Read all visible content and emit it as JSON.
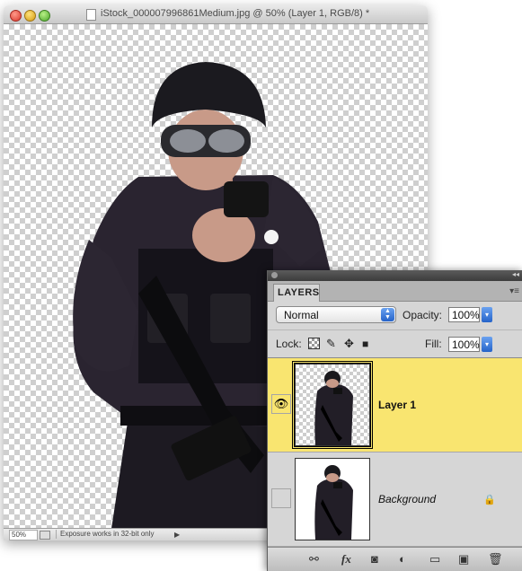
{
  "document": {
    "title": "iStock_000007996861Medium.jpg @ 50% (Layer 1, RGB/8) *",
    "status": {
      "zoom": "50%",
      "info": "Exposure works in 32-bit only"
    },
    "icons": [
      "close-icon",
      "minimize-icon",
      "zoom-icon",
      "document-icon"
    ]
  },
  "layers_panel": {
    "tab_label": "LAYERS",
    "blend_mode": "Normal",
    "opacity_label": "Opacity:",
    "opacity_value": "100%",
    "lock_label": "Lock:",
    "fill_label": "Fill:",
    "fill_value": "100%",
    "lock_icons": [
      "lock-transparent-pixels-icon",
      "lock-image-pixels-icon",
      "lock-position-icon",
      "lock-all-icon"
    ],
    "layers": [
      {
        "name": "Layer 1",
        "visible": true,
        "selected": true,
        "locked": false
      },
      {
        "name": "Background",
        "visible": false,
        "selected": false,
        "locked": true
      }
    ],
    "bottom_icons": [
      "link-layers-icon",
      "fx-icon",
      "add-mask-icon",
      "adjustment-layer-icon",
      "new-group-icon",
      "new-layer-icon",
      "trash-icon"
    ],
    "fx_glyph": "fx",
    "selected_color": "#f9e570"
  }
}
